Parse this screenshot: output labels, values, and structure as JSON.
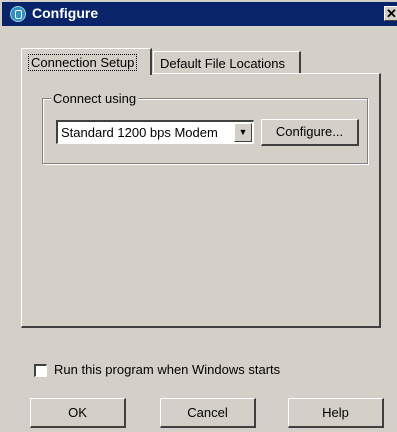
{
  "window": {
    "title": "Configure",
    "close_glyph": "✕",
    "icon": "app-icon"
  },
  "tabs": [
    {
      "label": "Connection Setup",
      "active": true
    },
    {
      "label": "Default File Locations",
      "active": false
    }
  ],
  "connect_group": {
    "label": "Connect using",
    "device_select": {
      "value": "Standard  1200 bps Modem",
      "arrow": "▼"
    },
    "configure_button": "Configure..."
  },
  "startup_checkbox": {
    "label": "Run this program when Windows starts",
    "checked": false
  },
  "buttons": {
    "ok": "OK",
    "cancel": "Cancel",
    "help": "Help"
  }
}
